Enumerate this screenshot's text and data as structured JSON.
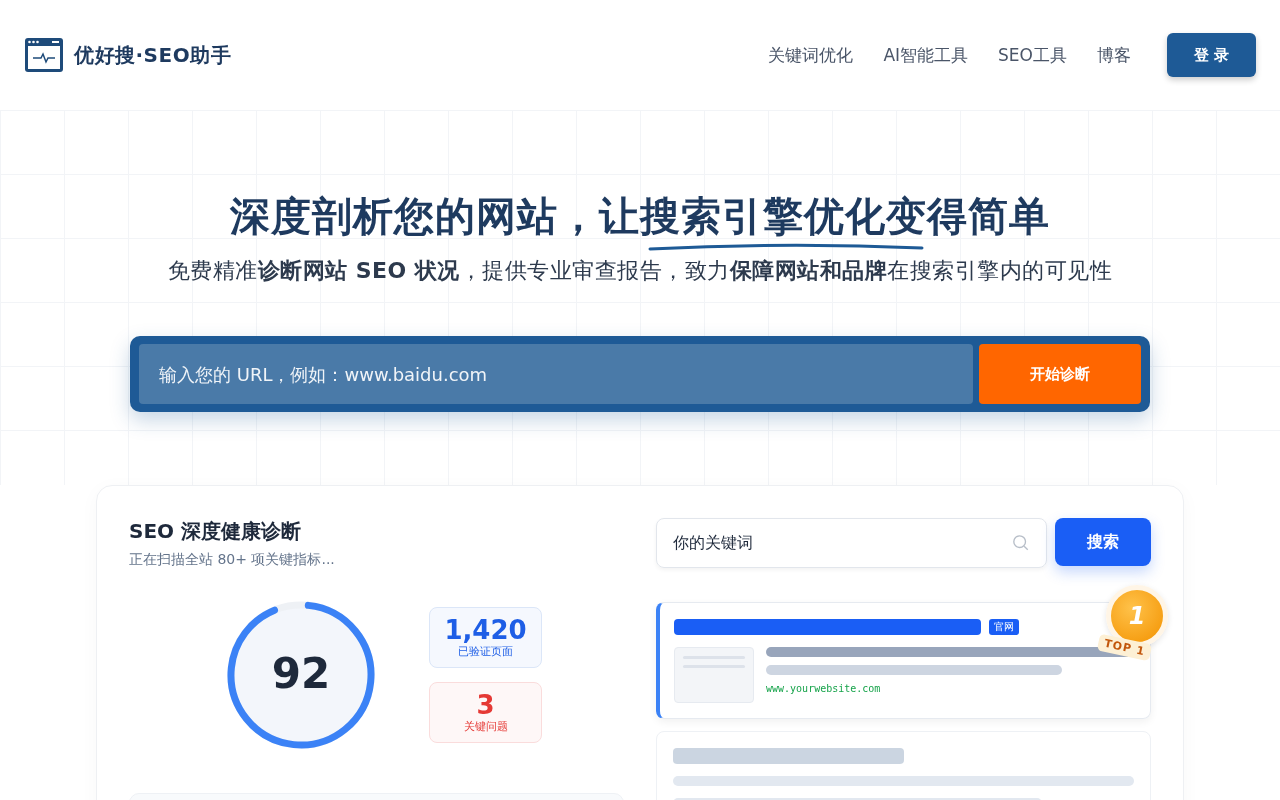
{
  "header": {
    "brand": "优好搜·SEO助手",
    "nav": [
      {
        "label": "关键词优化"
      },
      {
        "label": "AI智能工具"
      },
      {
        "label": "SEO工具"
      },
      {
        "label": "博客"
      }
    ],
    "login": "登 录"
  },
  "hero": {
    "title": "深度剖析您的网站，让搜索引擎优化变得简单",
    "subtitle": "免费精准**诊断网站 SEO 状况**，提供专业审查报告，致力**保障网站和品牌**在搜索引擎内的可见性",
    "url_placeholder": "输入您的 URL，例如：www.baidu.com",
    "submit": "开始诊断"
  },
  "diagnosis": {
    "title": "SEO 深度健康诊断",
    "subtitle": "正在扫描全站 80+ 项关键指标...",
    "score": "92",
    "level": 0.92,
    "stats": [
      {
        "value": "1,420",
        "label": "已验证页面",
        "kind": "info"
      },
      {
        "value": "3",
        "label": "关键问题",
        "kind": "alert"
      }
    ]
  },
  "serp": {
    "keyword": "你的关键词",
    "search": "搜索",
    "result": {
      "tag": "官网",
      "url": "www.yourwebsite.com",
      "badge": "TOP 1",
      "medal": "1"
    }
  }
}
